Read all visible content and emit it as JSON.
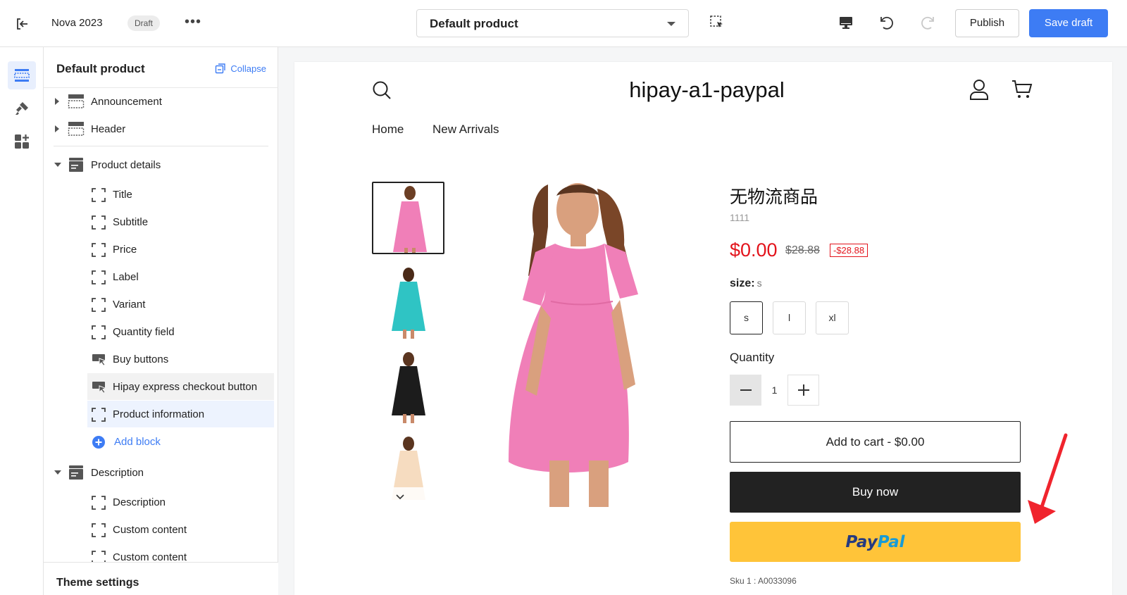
{
  "topbar": {
    "theme_name": "Nova 2023",
    "status_badge": "Draft",
    "more_label": "•••",
    "template_select": "Default product",
    "publish_label": "Publish",
    "save_label": "Save draft"
  },
  "rail": {
    "items": [
      {
        "icon": "sections-icon",
        "active": true
      },
      {
        "icon": "theme-style-icon",
        "active": false
      },
      {
        "icon": "apps-icon",
        "active": false
      }
    ]
  },
  "panel": {
    "title": "Default product",
    "collapse_label": "Collapse",
    "sections": {
      "announcement": "Announcement",
      "header": "Header",
      "product_details": "Product details",
      "description": "Description"
    },
    "product_blocks": [
      "Title",
      "Subtitle",
      "Price",
      "Label",
      "Variant",
      "Quantity field",
      "Buy buttons",
      "Hipay express checkout button",
      "Product information"
    ],
    "add_block": "Add block",
    "description_blocks": [
      "Description",
      "Custom content",
      "Custom content"
    ],
    "footer_label": "Theme settings"
  },
  "store": {
    "name": "hipay-a1-paypal",
    "nav": [
      "Home",
      "New Arrivals"
    ]
  },
  "product": {
    "title": "无物流商品",
    "sku": "1111",
    "price": "$0.00",
    "compare_price": "$28.88",
    "discount": "-$28.88",
    "size_label": "size:",
    "size_value": "s",
    "sizes": [
      "s",
      "l",
      "xl"
    ],
    "quantity_label": "Quantity",
    "quantity": "1",
    "add_to_cart": "Add to cart  -  $0.00",
    "buy_now": "Buy now",
    "paypal_pay": "Pay",
    "paypal_pal": "Pal",
    "footnote": "Sku 1 : A0033096",
    "thumb_colors": [
      "#f07fb8",
      "#2fc4c4",
      "#1c1c1c",
      "#f6dcc0"
    ]
  },
  "colors": {
    "accent": "#3d7cf4",
    "price_red": "#e3141c",
    "paypal_yellow": "#ffc439",
    "dress_pink": "#f07fb8"
  }
}
